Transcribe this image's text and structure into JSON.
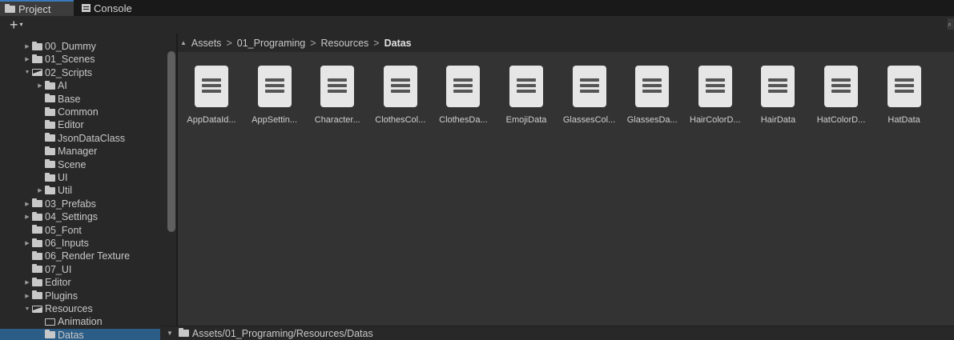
{
  "tabs": [
    {
      "label": "Project",
      "icon": "folder-icon"
    },
    {
      "label": "Console",
      "icon": "console-icon"
    }
  ],
  "toolbar": {
    "plus_label": "+",
    "caret": "▾"
  },
  "tree": [
    {
      "label": "00_Dummy",
      "arrow": "▶",
      "icon": "folder"
    },
    {
      "label": "01_Scenes",
      "arrow": "▶",
      "icon": "folder"
    },
    {
      "label": "02_Scripts",
      "arrow": "▼",
      "icon": "folder-open"
    },
    {
      "label": "AI",
      "arrow": "▶",
      "icon": "folder"
    },
    {
      "label": "Base",
      "arrow": "",
      "icon": "folder"
    },
    {
      "label": "Common",
      "arrow": "",
      "icon": "folder"
    },
    {
      "label": "Editor",
      "arrow": "",
      "icon": "folder"
    },
    {
      "label": "JsonDataClass",
      "arrow": "",
      "icon": "folder"
    },
    {
      "label": "Manager",
      "arrow": "",
      "icon": "folder"
    },
    {
      "label": "Scene",
      "arrow": "",
      "icon": "folder"
    },
    {
      "label": "UI",
      "arrow": "",
      "icon": "folder"
    },
    {
      "label": "Util",
      "arrow": "▶",
      "icon": "folder"
    },
    {
      "label": "03_Prefabs",
      "arrow": "▶",
      "icon": "folder"
    },
    {
      "label": "04_Settings",
      "arrow": "▶",
      "icon": "folder"
    },
    {
      "label": "05_Font",
      "arrow": "",
      "icon": "folder"
    },
    {
      "label": "06_Inputs",
      "arrow": "▶",
      "icon": "folder"
    },
    {
      "label": "06_Render Texture",
      "arrow": "",
      "icon": "folder"
    },
    {
      "label": "07_UI",
      "arrow": "",
      "icon": "folder"
    },
    {
      "label": "Editor",
      "arrow": "▶",
      "icon": "folder"
    },
    {
      "label": "Plugins",
      "arrow": "▶",
      "icon": "folder"
    },
    {
      "label": "Resources",
      "arrow": "▼",
      "icon": "folder-open"
    },
    {
      "label": "Animation",
      "arrow": "",
      "icon": "folder-empty"
    },
    {
      "label": "Datas",
      "arrow": "",
      "icon": "folder"
    }
  ],
  "breadcrumb": {
    "up_arrow": "▲",
    "items": [
      "Assets",
      "01_Programing",
      "Resources",
      "Datas"
    ],
    "separator": ">"
  },
  "assets": [
    "AppDataId...",
    "AppSettin...",
    "Character...",
    "ClothesCol...",
    "ClothesDa...",
    "EmojiData",
    "GlassesCol...",
    "GlassesDa...",
    "HairColorD...",
    "HairData",
    "HatColorD...",
    "HatData"
  ],
  "statusbar": {
    "caret": "▼",
    "path": "Assets/01_Programing/Resources/Datas"
  },
  "colors": {
    "accent": "#3a79bb",
    "selection": "#2c5d87",
    "panel": "#282828",
    "content": "#333333"
  }
}
